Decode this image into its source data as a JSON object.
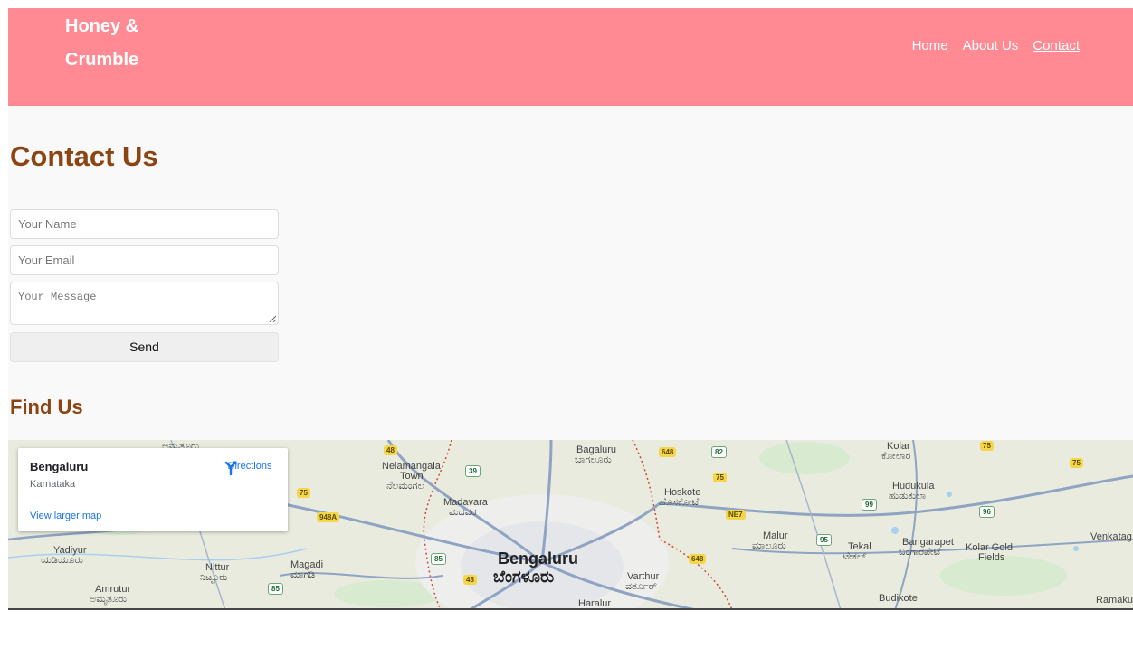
{
  "header": {
    "brand_line1": "Honey &",
    "brand_line2": "Crumble",
    "nav": [
      {
        "label": "Home"
      },
      {
        "label": "About Us"
      },
      {
        "label": "Contact",
        "active": true
      }
    ]
  },
  "contact": {
    "title": "Contact Us",
    "name_placeholder": "Your Name",
    "email_placeholder": "Your Email",
    "message_placeholder": "Your Message",
    "send_label": "Send"
  },
  "find": {
    "title": "Find Us"
  },
  "map": {
    "card": {
      "title": "Bengaluru",
      "subtitle": "Karnataka",
      "directions": "Directions",
      "larger_map": "View larger map"
    },
    "city_en": "Bengaluru",
    "city_kn": "ಬೆಂಗಳೂರು",
    "places": {
      "bagaluru": "Bagaluru",
      "bagaluru_kn": "ಬಾಗಲೂರು",
      "nelamangala": "Nelamangala",
      "town": "Town",
      "nelamangala_kn": "ನೆಲಮಂಗಲ",
      "madavara": "Madavara",
      "madavara_kn": "ಮದವರ",
      "hoskote": "Hoskote",
      "hoskote_kn": "ಹೊಸಕೋಟೆ",
      "kolar": "Kolar",
      "kolar_kn": "ಕೋಲಾರ",
      "hudukula": "Hudukula",
      "hudukula_kn": "ಹುಡುಕುಲಾ",
      "malur": "Malur",
      "malur_kn": "ಮಾಲೂರು",
      "tekal": "Tekal",
      "tekal_kn": "ಟೇಕಲ್",
      "bangarapet": "Bangarapet",
      "bangarapet_kn": "ಬಂಗಾರಪೇಟೆ",
      "kolar_gold": "Kolar Gold",
      "fields": "Fields",
      "venkatag": "Venkatag",
      "yadiyur": "Yadiyur",
      "yadiyur_kn": "ಯಡಿಯೂರು",
      "nittur": "Nittur",
      "nittur_kn": "ನಿಟ್ಟೂರು",
      "magadi": "Magadi",
      "magadi_kn": "ಮಾಗಡಿ",
      "amrutur": "Amrutur",
      "amrutur_kn": "ಅಮೃತೂರು",
      "varthur": "Varthur",
      "varthur_kn": "ವರ್ತೂರ್",
      "haralur": "Haralur",
      "budikote": "Budikote",
      "ramaku": "Ramaku"
    },
    "shields": {
      "s48a": "48",
      "s39": "39",
      "s648a": "648",
      "s82": "82",
      "s75a": "75",
      "s75b": "75",
      "s75c": "75",
      "s75d": "75",
      "s948a": "948A",
      "ne7": "NE7",
      "s99": "99",
      "s96": "96",
      "s95": "95",
      "s85a": "85",
      "s85b": "85",
      "s48b": "48",
      "s648b": "648"
    }
  },
  "colors": {
    "header_bg": "#ff8a94",
    "heading": "#8b4513",
    "link_blue": "#1a73e8"
  }
}
